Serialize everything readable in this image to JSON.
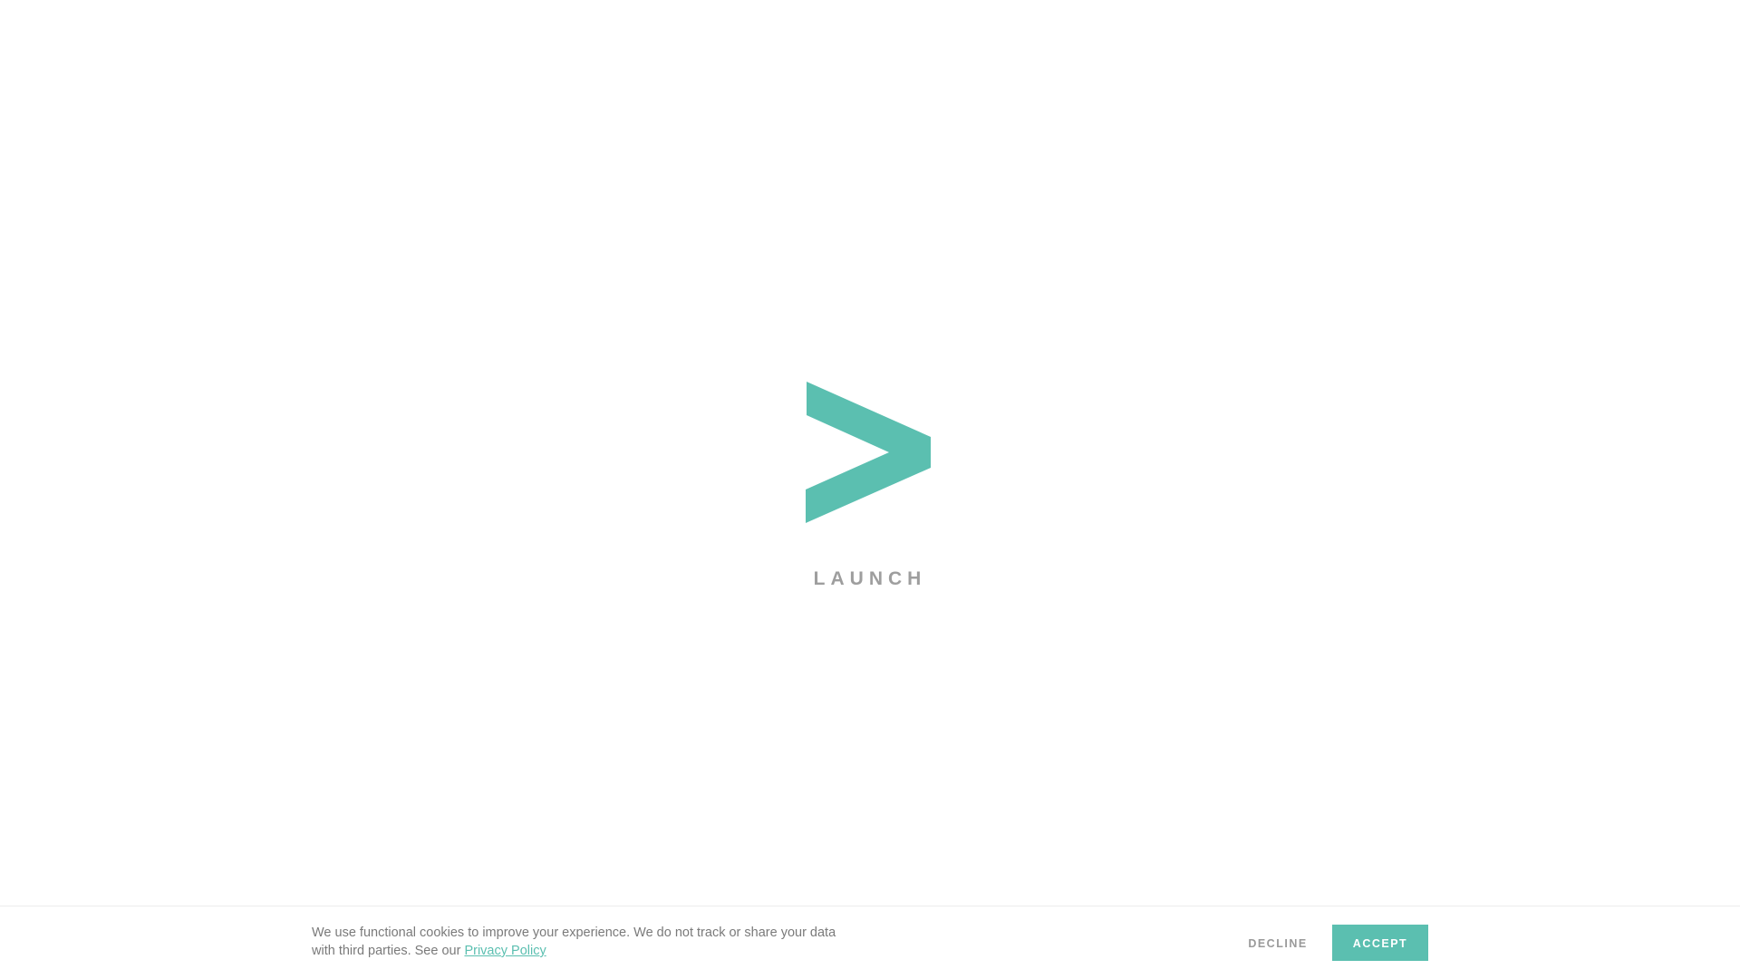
{
  "brand": {
    "name": "LAUNCH",
    "logo_icon": "chevron-right-logo",
    "accent_color": "#5bbfb0",
    "text_color": "#9e9e9e"
  },
  "cookie_banner": {
    "message": "We use functional cookies to improve your experience. We do not track or share your data with third parties. See our ",
    "link_label": "Privacy Policy",
    "decline_label": "DECLINE",
    "accept_label": "ACCEPT"
  }
}
